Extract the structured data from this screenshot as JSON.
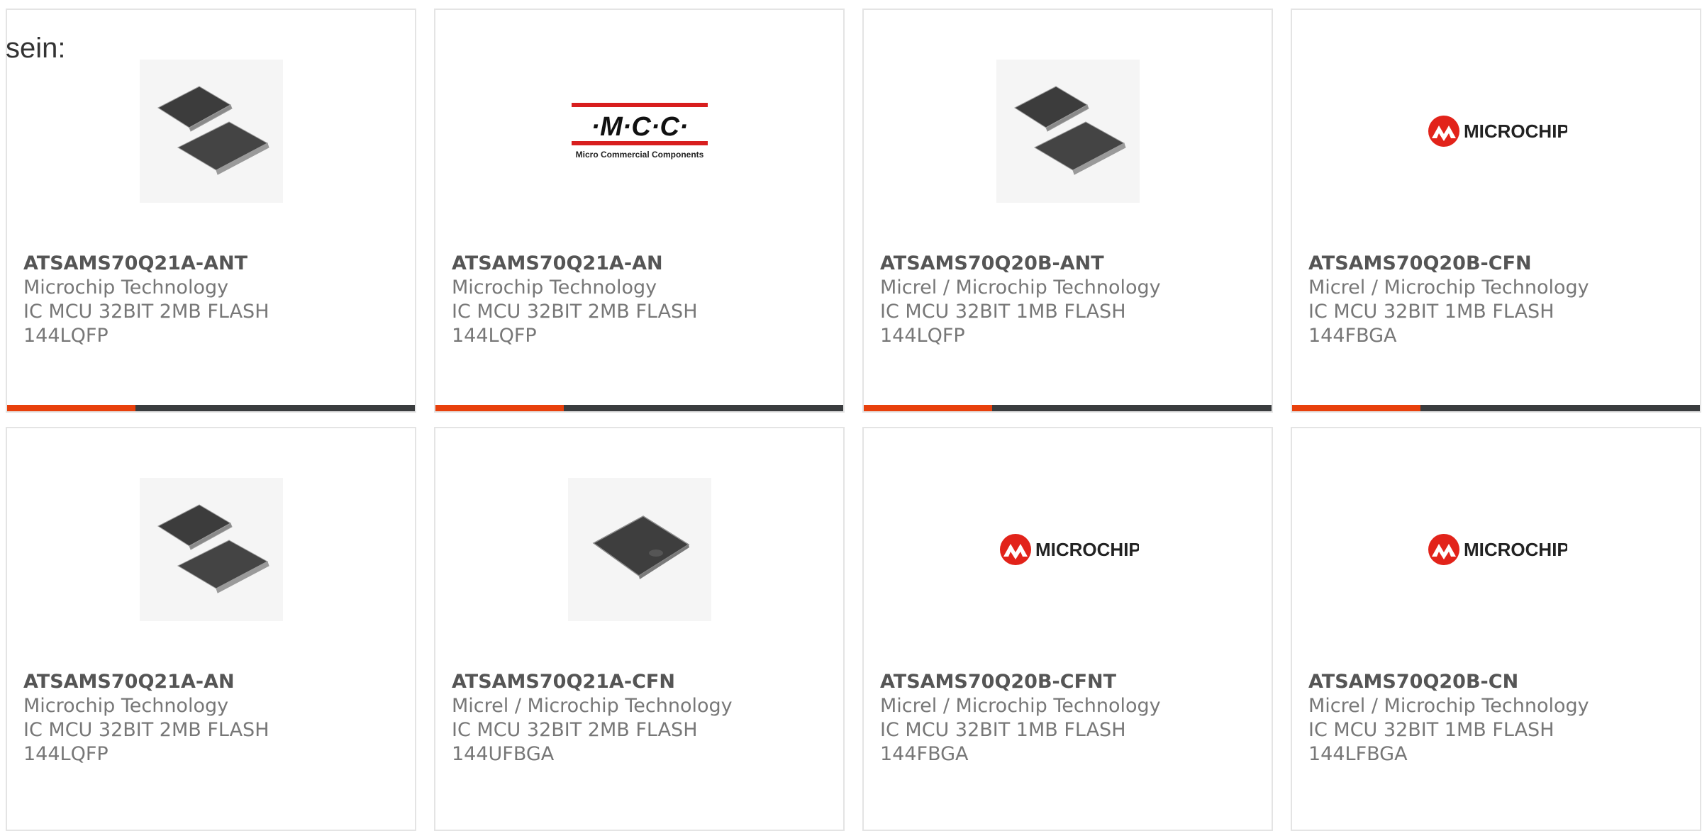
{
  "intro": "sein:",
  "colors": {
    "accent": "#e8400c",
    "bar": "#3a3c3e",
    "border": "#e4e4e4",
    "mcc_red": "#d81e1e",
    "microchip_red": "#e2231a"
  },
  "logos": {
    "mcc_mark": "·M·C·C·",
    "mcc_sub": "Micro Commercial Components",
    "microchip": "MICROCHIP"
  },
  "products": [
    {
      "part_number": "ATSAMS70Q21A-ANT",
      "manufacturer": "Microchip Technology",
      "description_line1": "IC MCU 32BIT 2MB FLASH",
      "description_line2": "144LQFP",
      "image": "lqfp-chip-photo"
    },
    {
      "part_number": "ATSAMS70Q21A-AN",
      "manufacturer": "Microchip Technology",
      "description_line1": "IC MCU 32BIT 2MB FLASH",
      "description_line2": "144LQFP",
      "image": "mcc-logo"
    },
    {
      "part_number": "ATSAMS70Q20B-ANT",
      "manufacturer": "Micrel / Microchip Technology",
      "description_line1": "IC MCU 32BIT 1MB FLASH",
      "description_line2": "144LQFP",
      "image": "lqfp-chip-photo"
    },
    {
      "part_number": "ATSAMS70Q20B-CFN",
      "manufacturer": "Micrel / Microchip Technology",
      "description_line1": "IC MCU 32BIT 1MB FLASH",
      "description_line2": "144FBGA",
      "image": "microchip-logo"
    },
    {
      "part_number": "ATSAMS70Q21A-AN",
      "manufacturer": "Microchip Technology",
      "description_line1": "IC MCU 32BIT 2MB FLASH",
      "description_line2": "144LQFP",
      "image": "lqfp-chip-photo"
    },
    {
      "part_number": "ATSAMS70Q21A-CFN",
      "manufacturer": "Micrel / Microchip Technology",
      "description_line1": "IC MCU 32BIT 2MB FLASH",
      "description_line2": "144UFBGA",
      "image": "bga-chip-photo"
    },
    {
      "part_number": "ATSAMS70Q20B-CFNT",
      "manufacturer": "Micrel / Microchip Technology",
      "description_line1": "IC MCU 32BIT 1MB FLASH",
      "description_line2": "144FBGA",
      "image": "microchip-logo"
    },
    {
      "part_number": "ATSAMS70Q20B-CN",
      "manufacturer": "Micrel / Microchip Technology",
      "description_line1": "IC MCU 32BIT 1MB FLASH",
      "description_line2": "144LFBGA",
      "image": "microchip-logo"
    }
  ]
}
